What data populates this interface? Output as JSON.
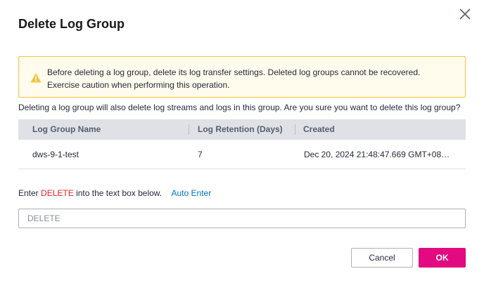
{
  "dialog": {
    "title": "Delete Log Group",
    "close_icon": "close-icon"
  },
  "alert": {
    "icon": "warning-icon",
    "text": "Before deleting a log group, delete its log transfer settings. Deleted log groups cannot be recovered. Exercise caution when performing this operation."
  },
  "confirm_text": "Deleting a log group will also delete log streams and logs in this group. Are you sure you want to delete this log group?",
  "table": {
    "headers": [
      "Log Group Name",
      "Log Retention (Days)",
      "Created"
    ],
    "rows": [
      [
        "dws-9-1-test",
        "7",
        "Dec 20, 2024 21:48:47.669 GMT+08:00"
      ]
    ]
  },
  "enter": {
    "prefix": "Enter",
    "keyword": "DELETE",
    "suffix": "into the text box below.",
    "auto_enter": "Auto Enter"
  },
  "input": {
    "value": "",
    "placeholder": "DELETE"
  },
  "buttons": {
    "cancel": "Cancel",
    "ok": "OK"
  },
  "colors": {
    "primary": "#e3097f",
    "warning": "#f5c342",
    "link": "#0073c8",
    "keyword": "#e6212a"
  }
}
